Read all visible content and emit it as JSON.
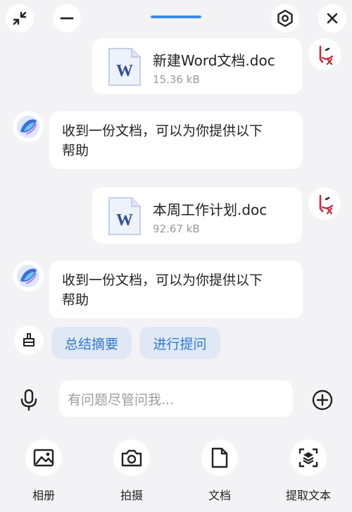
{
  "top_bar": {
    "buttons": [
      "collapse",
      "minimize",
      "settings",
      "close"
    ]
  },
  "messages": [
    {
      "type": "file",
      "from": "user",
      "file_name": "新建Word文档.doc",
      "file_size": "15.36 kB",
      "file_icon_letter": "W"
    },
    {
      "type": "text",
      "from": "bot",
      "line1": "收到一份文档，可以为你提供以下",
      "line2": "帮助"
    },
    {
      "type": "file",
      "from": "user",
      "file_name": "本周工作计划.doc",
      "file_size": "92.67 kB",
      "file_icon_letter": "W"
    },
    {
      "type": "text",
      "from": "bot",
      "line1": "收到一份文档，可以为你提供以下",
      "line2": "帮助"
    }
  ],
  "suggestions": [
    "总结摘要",
    "进行提问"
  ],
  "input": {
    "placeholder": "有问题尽管问我..."
  },
  "tools": [
    {
      "label": "相册",
      "icon": "image-icon"
    },
    {
      "label": "拍摄",
      "icon": "camera-icon"
    },
    {
      "label": "文档",
      "icon": "document-icon"
    },
    {
      "label": "提取文本",
      "icon": "scan-text-icon"
    }
  ],
  "colors": {
    "accent": "#2f7ad1",
    "chip_bg": "#dfe8f4",
    "background": "#f3f3f5",
    "handle": "#3b8ee8"
  }
}
